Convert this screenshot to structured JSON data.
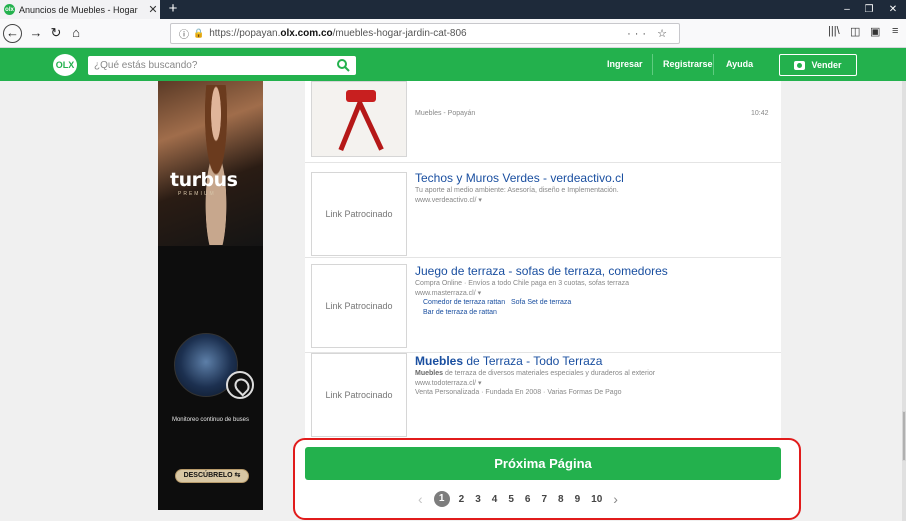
{
  "browser": {
    "tab_title": "Anuncios de Muebles - Hogar",
    "tab_favicon": "olx",
    "url_prefix": "https://popayan.",
    "url_domain": "olx.com.co",
    "url_path": "/muebles-hogar-jardin-cat-806",
    "url_actions": "··· ☆"
  },
  "header": {
    "logo": "OLX",
    "search_placeholder": "¿Qué estás buscando?",
    "links": [
      "Ingresar",
      "Registrarse",
      "Ayuda"
    ],
    "vender_label": "Vender",
    "brand_color": "#23b14d"
  },
  "banner": {
    "brand": "turbus",
    "tier": "PREMIUM",
    "caption": "Monitoreo continuo de buses",
    "cta": "DESCÚBRELO ⇆"
  },
  "listings": {
    "first": {
      "meta": "Muebles - Popayán",
      "time": "10:42"
    },
    "sponsored_label": "Link Patrocinado",
    "ads": [
      {
        "title": "Techos y Muros Verdes - verdeactivo.cl",
        "desc": "Tu aporte al medio ambiente: Asesoría, diseño e Implementación.",
        "url": "www.verdeactivo.cl/ ▾"
      },
      {
        "title": "Juego de terraza - sofas de terraza, comedores",
        "desc": "Compra Online · Envíos a todo Chile paga en 3 cuotas, sofas terraza",
        "url": "www.masterraza.cl/ ▾",
        "sublinks": [
          "Comedor de terraza rattan",
          "Sofa Set de terraza",
          "Bar de terraza de rattan"
        ]
      },
      {
        "title_bold": "Muebles",
        "title_rest": " de Terraza - Todo Terraza",
        "desc_bold": "Muebles",
        "desc_rest": " de terraza de diversos materiales especiales y duraderos al exterior",
        "url": "www.todoterraza.cl/ ▾",
        "extra": "Venta Personalizada · Fundada En 2008 · Varias Formas De Pago"
      }
    ]
  },
  "pagination": {
    "next_label": "Próxima Página",
    "prev_arrow": "‹",
    "next_arrow": "›",
    "pages": [
      "1",
      "2",
      "3",
      "4",
      "5",
      "6",
      "7",
      "8",
      "9",
      "10"
    ],
    "current": "1"
  }
}
